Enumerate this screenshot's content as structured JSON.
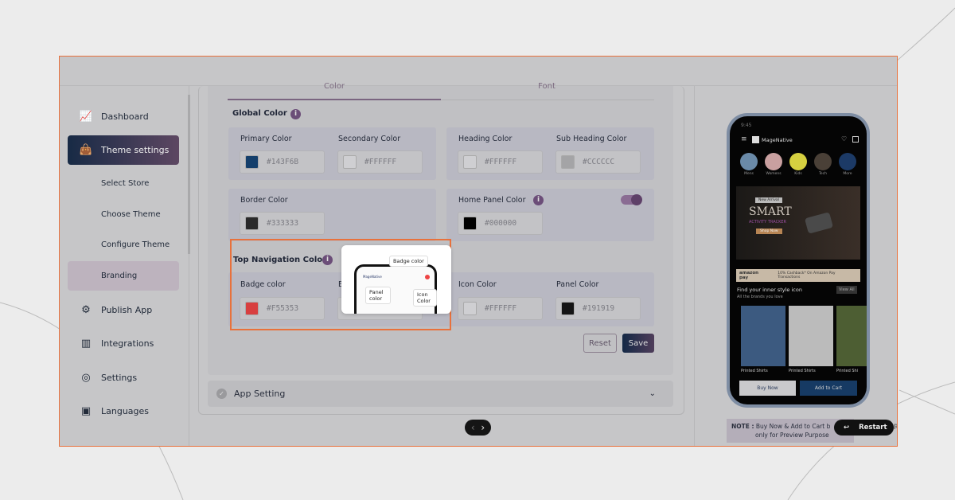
{
  "sidebar": {
    "items": [
      {
        "label": "Dashboard",
        "icon": "chart-icon"
      },
      {
        "label": "Theme settings",
        "icon": "bag-icon",
        "active": true
      },
      {
        "label": "Select Store"
      },
      {
        "label": "Choose Theme"
      },
      {
        "label": "Configure Theme"
      },
      {
        "label": "Branding"
      },
      {
        "label": "Publish App",
        "icon": "gear-icon"
      },
      {
        "label": "Integrations",
        "icon": "bar-chart-icon"
      },
      {
        "label": "Settings",
        "icon": "compass-icon"
      },
      {
        "label": "Languages",
        "icon": "wallet-icon"
      }
    ]
  },
  "tabs": [
    "Color",
    "Font"
  ],
  "global": {
    "title": "Global Color",
    "fields": [
      {
        "label": "Primary Color",
        "value": "#143F6B",
        "swatch": "#143F6B"
      },
      {
        "label": "Secondary Color",
        "value": "#FFFFFF",
        "swatch": "#FFFFFF"
      },
      {
        "label": "Heading Color",
        "value": "#FFFFFF",
        "swatch": "#FFFFFF"
      },
      {
        "label": "Sub Heading Color",
        "value": "#CCCCCC",
        "swatch": "#CCCCCC"
      },
      {
        "label": "Border Color",
        "value": "#333333",
        "swatch": "#333333"
      },
      {
        "label": "Home Panel Color",
        "value": "#000000",
        "swatch": "#000000",
        "toggle_on": true
      }
    ]
  },
  "topnav": {
    "title": "Top Navigation Color",
    "fields": [
      {
        "label": "Badge color",
        "value": "#F55353",
        "swatch": "#F55353"
      },
      {
        "label": "B",
        "value": ""
      },
      {
        "label": "Icon Color",
        "value": "#FFFFFF",
        "swatch": "#FFFFFF"
      },
      {
        "label": "Panel Color",
        "value": "#191919",
        "swatch": "#191919"
      }
    ],
    "tooltip": {
      "badge": "Badge color",
      "panel": "Panel color",
      "icon": "Icon Color",
      "brand": "MageNative"
    }
  },
  "buttons": {
    "reset": "Reset",
    "save": "Save"
  },
  "app_setting": "App Setting",
  "phone": {
    "time": "9:45",
    "brand": "MageNative",
    "categories": [
      "Mens",
      "Womens",
      "Kids",
      "Tech",
      "More"
    ],
    "banner": {
      "tag": "New Arrival",
      "title": "SMART",
      "subtitle": "ACTIVITY TRACKER",
      "cta": "Shop Now"
    },
    "promo": {
      "brand": "amazon pay",
      "text": "10% Cashback* On Amazon Pay Transactions"
    },
    "section_title": "Find your inner style icon",
    "section_sub": "All the brands you love",
    "view_all": "View All",
    "products": [
      "Printed Shirts",
      "Printed Shirts",
      "Printed Shi"
    ],
    "buy_now": "Buy Now",
    "add_to_cart": "Add to Cart"
  },
  "note": {
    "label": "NOTE :",
    "text": "Buy Now & Add to Cart b",
    "text2": "only for Preview Purpose"
  },
  "restart": {
    "label": "Restart",
    "key": "R"
  },
  "colors": {
    "accent": "#e8713c",
    "primary": "#143F6B",
    "purple": "#6b4d78"
  }
}
